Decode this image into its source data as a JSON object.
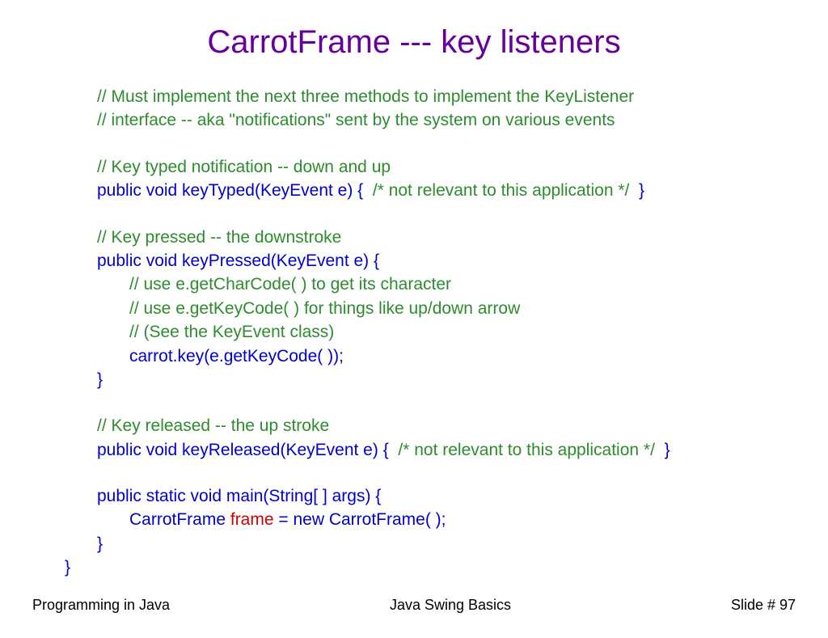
{
  "title": "CarrotFrame --- key listeners",
  "code": {
    "c1a": "// Must implement the next three methods to implement the KeyListener",
    "c1b": "// interface -- aka \"notifications\" sent by the system on various events",
    "c2": "// Key typed notification -- down and up",
    "sig1_a": "public void keyTyped(KeyEvent e) {  ",
    "sig1_c": "/* not relevant to this application */",
    "sig1_b": "  }",
    "c3": "// Key pressed -- the downstroke",
    "sig2": "public void keyPressed(KeyEvent e) {",
    "c4": "// use e.getCharCode( ) to get its character",
    "c5": "// use e.getKeyCode( ) for things like up/down arrow",
    "c6": "// (See the KeyEvent class)",
    "body1": "carrot.key(e.getKeyCode( ));",
    "brace1": "}",
    "c7": "// Key released -- the up stroke",
    "sig3_a": "public void keyReleased(KeyEvent e) {  ",
    "sig3_c": "/* not relevant to this application */",
    "sig3_b": "  }",
    "sig4": "public static void main(String[ ] args) {",
    "body2a": "CarrotFrame ",
    "body2b": "frame",
    "body2c": " = new CarrotFrame( );",
    "brace2": "}",
    "brace3": "}"
  },
  "footer": {
    "left": "Programming in Java",
    "center": "Java Swing Basics",
    "right": "Slide # 97"
  }
}
